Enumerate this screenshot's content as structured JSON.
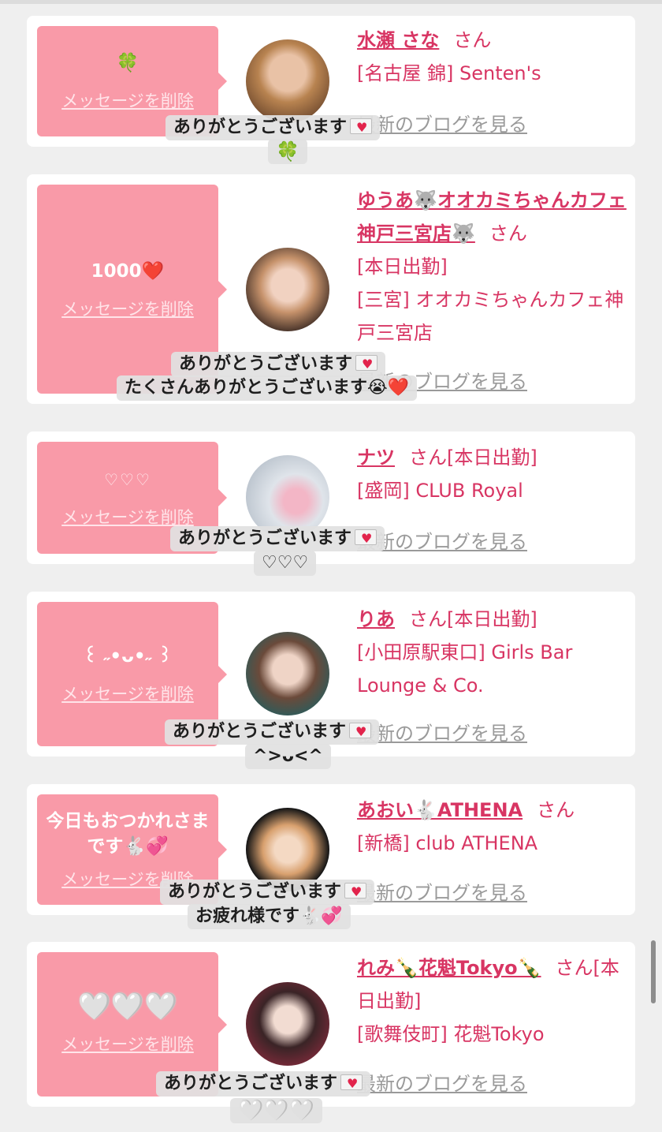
{
  "delete_label": "メッセージを削除",
  "colors": {
    "accent": "#d83563",
    "bubble": "#f99aa8",
    "background": "#efefef",
    "link_gray": "#9a9a9a"
  },
  "cards": [
    {
      "message": "🍀",
      "name": "水瀬 さな",
      "honorific": "さん",
      "lines": [
        "[名古屋 錦] Senten's"
      ],
      "blog_link": "最新のブログを見る",
      "reply_lines": [
        "ありがとうございます",
        "🍀"
      ]
    },
    {
      "message": "1000❤️",
      "name": "ゆうあ🐺オオカミちゃんカフェ神戸三宮店🐺",
      "honorific": "さん",
      "lines": [
        "[本日出勤]",
        "[三宮] オオカミちゃんカフェ神戸三宮店"
      ],
      "blog_link": "最新のブログを見る",
      "reply_lines": [
        "ありがとうございます",
        "たくさんありがとうございます😭❤️"
      ]
    },
    {
      "message": "♡♡♡",
      "name": "ナツ",
      "honorific": "さん",
      "status": "[本日出勤]",
      "lines": [
        "[盛岡] CLUB Royal"
      ],
      "blog_link": "最新のブログを見る",
      "reply_lines": [
        "ありがとうございます",
        "♡♡♡"
      ]
    },
    {
      "message": "꒰ ˶•ᴗ•˶ ꒱",
      "name": "りあ",
      "honorific": "さん",
      "status": "[本日出勤]",
      "lines": [
        "[小田原駅東口] Girls Bar Lounge & Co."
      ],
      "blog_link": "最新のブログを見る",
      "reply_lines": [
        "ありがとうございます",
        "^>ᴗ<^"
      ]
    },
    {
      "message": "今日もおつかれさまです🐇💞",
      "name": "あおい🐇ATHENA",
      "honorific": "さん",
      "lines": [
        "[新橋] club ATHENA"
      ],
      "blog_link": "最新のブログを見る",
      "reply_lines": [
        "ありがとうございます",
        "お疲れ様です🐇💞"
      ]
    },
    {
      "message": "🤍🤍🤍",
      "name": "れみ🍾花魁Tokyo🍾",
      "honorific": "さん",
      "status": "[本日出勤]",
      "lines": [
        "[歌舞伎町] 花魁Tokyo"
      ],
      "blog_link": "最新のブログを見る",
      "reply_lines": [
        "ありがとうございます",
        "🤍🤍🤍"
      ]
    }
  ]
}
